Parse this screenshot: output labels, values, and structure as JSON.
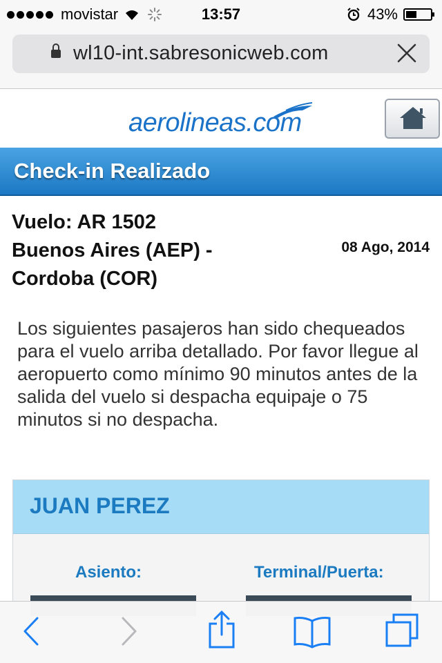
{
  "status_bar": {
    "carrier": "movistar",
    "time": "13:57",
    "battery_text": "43%",
    "battery_level": 0.43
  },
  "url_bar": {
    "url": "wl10-int.sabresonicweb.com"
  },
  "header": {
    "logo_text": "aerolineas.com"
  },
  "page": {
    "title": "Check-in Realizado",
    "flight_line": "Vuelo: AR 1502",
    "route_line1": "Buenos Aires (AEP) -",
    "route_line2": "Cordoba (COR)",
    "date": "08 Ago, 2014",
    "description": "Los siguientes pasajeros han sido chequeados para el vuelo arriba detallado. Por favor llegue al aeropuerto como mínimo 90 minutos antes de la salida del vuelo si despacha equipaje o 75 minutos si no despacha."
  },
  "passenger": {
    "name": "JUAN PEREZ",
    "seat_label": "Asiento:",
    "terminal_label": "Terminal/Puerta:"
  },
  "colors": {
    "brand_blue": "#1b7ac0",
    "title_band": "#2b8ad2",
    "card_header": "#a6dcf5",
    "ios_tint": "#1a7ef5"
  },
  "toolbar": {
    "icons": [
      "back-icon",
      "forward-icon",
      "share-icon",
      "bookmarks-icon",
      "tabs-icon"
    ]
  }
}
